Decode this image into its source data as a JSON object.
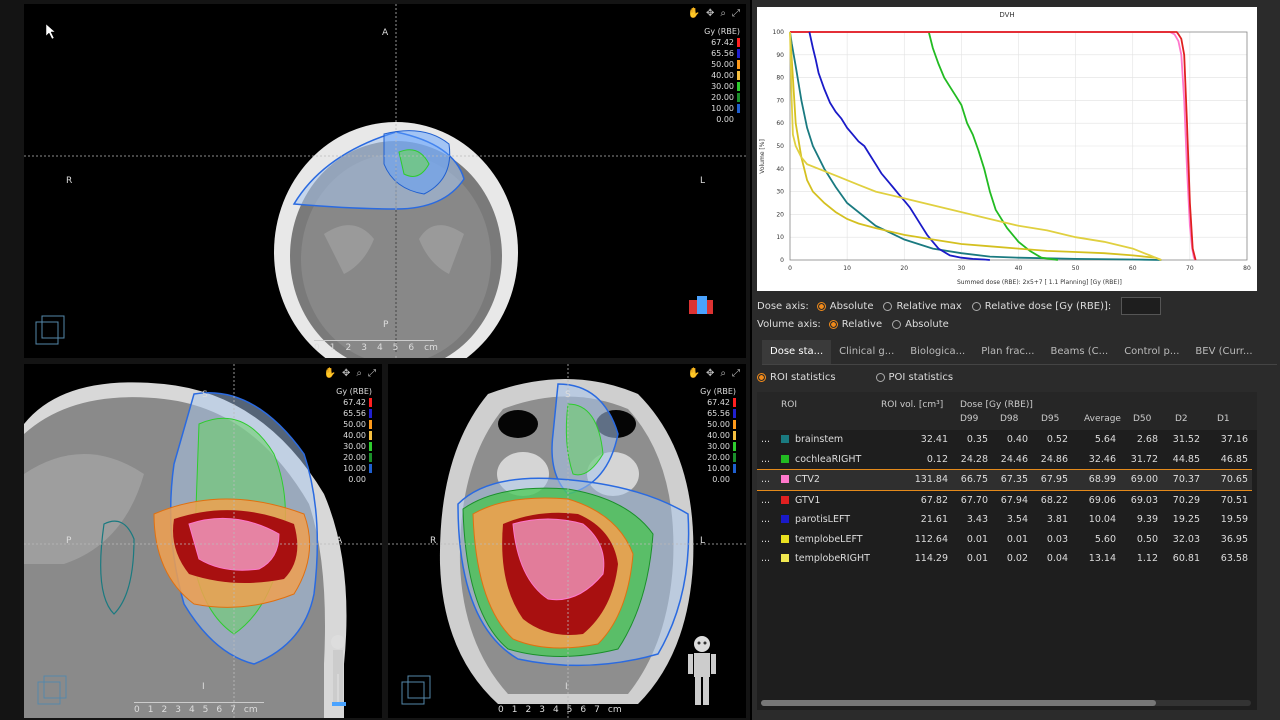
{
  "viewports": {
    "axial": {
      "orientation": {
        "top": "A",
        "left": "R",
        "right": "L",
        "bottom": "P"
      },
      "scale_ticks": [
        "0",
        "1",
        "2",
        "3",
        "4",
        "5",
        "6"
      ],
      "scale_unit": "cm"
    },
    "sagittal": {
      "orientation": {
        "top": "S",
        "left": "P",
        "right": "A",
        "bottom": "I"
      },
      "scale_ticks": [
        "0",
        "1",
        "2",
        "3",
        "4",
        "5",
        "6",
        "7"
      ],
      "scale_unit": "cm"
    },
    "coronal": {
      "orientation": {
        "top": "S",
        "left": "R",
        "right": "L",
        "bottom": "I"
      },
      "scale_ticks": [
        "0",
        "1",
        "2",
        "3",
        "4",
        "5",
        "6",
        "7"
      ],
      "scale_unit": "cm"
    },
    "dose_legend": {
      "unit": "Gy (RBE)",
      "levels": [
        {
          "label": "67.42",
          "color": "#ff2020"
        },
        {
          "label": "65.56",
          "color": "#ff3a3a"
        },
        {
          "label": "50.00",
          "color": "#ff9a1a"
        },
        {
          "label": "40.00",
          "color": "#f5c040"
        },
        {
          "label": "30.00",
          "color": "#2ecc2e"
        },
        {
          "label": "20.00",
          "color": "#1a8f2a"
        },
        {
          "label": "10.00",
          "color": "#1f5fd0"
        },
        {
          "label": "0.00",
          "color": "#5aa0ff"
        }
      ],
      "legend_unit_sag": "Gy (RBE)",
      "legend_unit_cor": "Gy (RBE)"
    }
  },
  "dvh": {
    "title": "DVH",
    "x_label": "Summed dose (RBE): 2x5+7 [ 1.1 Planning] [Gy (RBE)]",
    "y_label": "Volume [%]",
    "x_ticks": [
      "0",
      "10",
      "20",
      "30",
      "40",
      "50",
      "60",
      "70",
      "80"
    ],
    "y_ticks": [
      "0",
      "10",
      "20",
      "30",
      "40",
      "50",
      "60",
      "70",
      "80",
      "90",
      "100"
    ]
  },
  "chart_data": {
    "type": "line",
    "title": "DVH",
    "xlabel": "Summed dose (RBE): 2x5+7 [ 1.1 Planning] [Gy (RBE)]",
    "ylabel": "Volume [%]",
    "xlim": [
      0,
      80
    ],
    "ylim": [
      0,
      100
    ],
    "grid": true,
    "series": [
      {
        "name": "brainstem",
        "color": "#1a7a80",
        "x": [
          0,
          0.3,
          1,
          2,
          3,
          4,
          6,
          8,
          10,
          15,
          20,
          25,
          30,
          35,
          40,
          50,
          60,
          65
        ],
        "y": [
          100,
          95,
          85,
          70,
          58,
          50,
          40,
          32,
          25,
          15,
          9,
          5,
          3,
          1.5,
          1,
          0.5,
          0.2,
          0
        ]
      },
      {
        "name": "cochleaRIGHT",
        "color": "#22bb22",
        "x": [
          24.3,
          25,
          26,
          27,
          28,
          29,
          30,
          31,
          32,
          33,
          34,
          35,
          36,
          38,
          40,
          42,
          44,
          46.9
        ],
        "y": [
          100,
          93,
          86,
          80,
          76,
          72,
          68,
          60,
          55,
          48,
          40,
          30,
          22,
          14,
          8,
          4,
          1,
          0
        ]
      },
      {
        "name": "CTV2",
        "color": "#ff77cc",
        "x": [
          0,
          60,
          65,
          66.5,
          67.3,
          68,
          68.5,
          69,
          69.5,
          70,
          70.4,
          70.7,
          71
        ],
        "y": [
          100,
          100,
          100,
          100,
          99,
          96,
          90,
          70,
          40,
          15,
          5,
          1,
          0
        ]
      },
      {
        "name": "GTV1",
        "color": "#e02020",
        "x": [
          0,
          67.7,
          68,
          68.5,
          69,
          69.5,
          70,
          70.5,
          71
        ],
        "y": [
          100,
          100,
          99,
          97,
          90,
          60,
          25,
          5,
          0
        ]
      },
      {
        "name": "parotisLEFT",
        "color": "#1a1ac8",
        "x": [
          3.4,
          4,
          4.5,
          5,
          6,
          7,
          8,
          9,
          10,
          11,
          12,
          13,
          14,
          15,
          16,
          17,
          18,
          19,
          20,
          21,
          22,
          23,
          24,
          25,
          26,
          28,
          30,
          32,
          34,
          35
        ],
        "y": [
          100,
          93,
          88,
          82,
          75,
          69,
          65,
          62,
          58,
          55,
          52,
          50,
          46,
          42,
          38,
          35,
          32,
          29,
          26,
          23,
          19,
          15,
          11,
          8,
          5,
          2,
          1,
          0.5,
          0.2,
          0
        ]
      },
      {
        "name": "templobeLEFT",
        "color": "#d4c020",
        "x": [
          0,
          0.5,
          1,
          2,
          3,
          4,
          6,
          8,
          10,
          12,
          15,
          20,
          25,
          30,
          35,
          40,
          45,
          50,
          55,
          60,
          62,
          64,
          65
        ],
        "y": [
          100,
          80,
          60,
          45,
          35,
          30,
          25,
          21,
          18,
          16,
          14,
          11,
          9,
          7,
          6,
          5,
          4,
          3.5,
          3,
          2,
          1.5,
          1,
          0
        ]
      },
      {
        "name": "templobeRIGHT",
        "color": "#e0d040",
        "x": [
          0,
          0.3,
          0.5,
          1,
          2,
          3,
          5,
          8,
          10,
          12,
          15,
          20,
          25,
          30,
          35,
          40,
          45,
          50,
          55,
          60,
          62,
          63,
          64,
          65
        ],
        "y": [
          100,
          70,
          55,
          50,
          45,
          42,
          40,
          37,
          35,
          33,
          30,
          27,
          24,
          21,
          18,
          15,
          13,
          10,
          8,
          5,
          3,
          2,
          1,
          0
        ]
      }
    ]
  },
  "axes_controls": {
    "dose_axis_label": "Dose axis:",
    "dose_options": [
      "Absolute",
      "Relative max",
      "Relative dose [Gy (RBE)]:"
    ],
    "dose_selected": "Absolute",
    "relative_dose_value": "",
    "volume_axis_label": "Volume axis:",
    "volume_options": [
      "Relative",
      "Absolute"
    ],
    "volume_selected": "Relative"
  },
  "tabs": [
    "Dose sta...",
    "Clinical g...",
    "Biologica...",
    "Plan frac...",
    "Beams (C...",
    "Control p...",
    "BEV (Curr..."
  ],
  "active_tab": "Dose sta...",
  "stats_mode": {
    "options": [
      "ROI statistics",
      "POI statistics"
    ],
    "selected": "ROI statistics"
  },
  "table": {
    "headers": {
      "roi": "ROI",
      "roi_vol": "ROI vol. [cm³]",
      "dose_group": "Dose [Gy (RBE)]",
      "d99": "D99",
      "d98": "D98",
      "d95": "D95",
      "average": "Average",
      "d50": "D50",
      "d2": "D2",
      "d1": "D1"
    },
    "rows": [
      {
        "name": "brainstem",
        "color": "#1a7a80",
        "vol": "32.41",
        "d99": "0.35",
        "d98": "0.40",
        "d95": "0.52",
        "avg": "5.64",
        "d50": "2.68",
        "d2": "31.52",
        "d1": "37.16"
      },
      {
        "name": "cochleaRIGHT",
        "color": "#22bb22",
        "vol": "0.12",
        "d99": "24.28",
        "d98": "24.46",
        "d95": "24.86",
        "avg": "32.46",
        "d50": "31.72",
        "d2": "44.85",
        "d1": "46.85"
      },
      {
        "name": "CTV2",
        "color": "#ff77cc",
        "vol": "131.84",
        "d99": "66.75",
        "d98": "67.35",
        "d95": "67.95",
        "avg": "68.99",
        "d50": "69.00",
        "d2": "70.37",
        "d1": "70.65"
      },
      {
        "name": "GTV1",
        "color": "#e02020",
        "vol": "67.82",
        "d99": "67.70",
        "d98": "67.94",
        "d95": "68.22",
        "avg": "69.06",
        "d50": "69.03",
        "d2": "70.29",
        "d1": "70.51"
      },
      {
        "name": "parotisLEFT",
        "color": "#1a1ac8",
        "vol": "21.61",
        "d99": "3.43",
        "d98": "3.54",
        "d95": "3.81",
        "avg": "10.04",
        "d50": "9.39",
        "d2": "19.25",
        "d1": "19.59"
      },
      {
        "name": "templobeLEFT",
        "color": "#e8e020",
        "vol": "112.64",
        "d99": "0.01",
        "d98": "0.01",
        "d95": "0.03",
        "avg": "5.60",
        "d50": "0.50",
        "d2": "32.03",
        "d1": "36.95"
      },
      {
        "name": "templobeRIGHT",
        "color": "#f0e850",
        "vol": "114.29",
        "d99": "0.01",
        "d98": "0.02",
        "d95": "0.04",
        "avg": "13.14",
        "d50": "1.12",
        "d2": "60.81",
        "d1": "63.58"
      }
    ],
    "selected_row": "CTV2",
    "row_menu": "..."
  }
}
